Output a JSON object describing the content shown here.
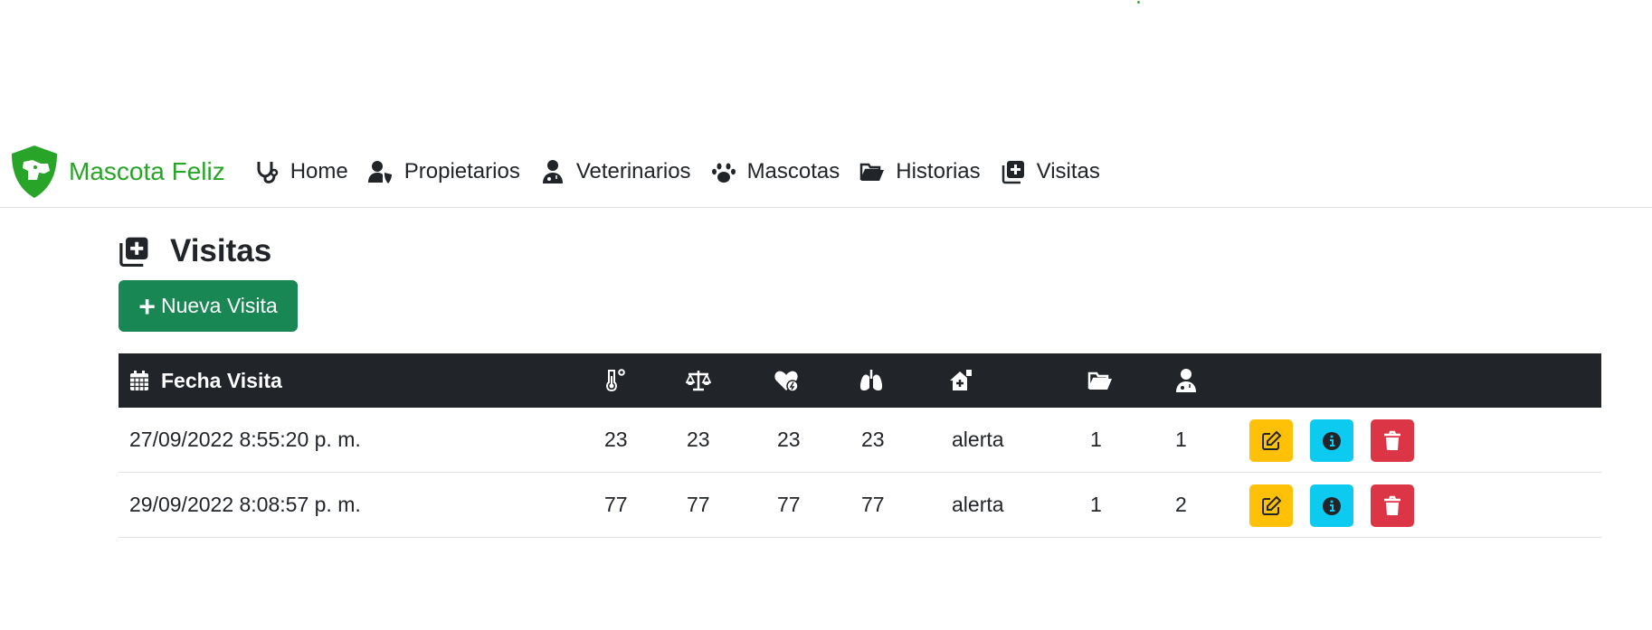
{
  "brand": {
    "name": "Mascota Feliz",
    "logo_icon": "dog-shield-icon",
    "color": "#28a428"
  },
  "nav": {
    "items": [
      {
        "label": "Home",
        "icon": "stethoscope-icon"
      },
      {
        "label": "Propietarios",
        "icon": "user-shield-icon"
      },
      {
        "label": "Veterinarios",
        "icon": "user-doctor-icon"
      },
      {
        "label": "Mascotas",
        "icon": "paw-icon"
      },
      {
        "label": "Historias",
        "icon": "folder-open-icon"
      },
      {
        "label": "Visitas",
        "icon": "notes-medical-icon"
      }
    ]
  },
  "page": {
    "title": "Visitas",
    "title_icon": "notes-medical-icon",
    "new_button": {
      "label": "Nueva Visita",
      "color": "#198754"
    }
  },
  "table": {
    "header": {
      "date_label": "Fecha Visita",
      "icons": [
        "calendar-icon",
        "temperature-icon",
        "scale-icon",
        "heart-pulse-icon",
        "lungs-icon",
        "house-medical-icon",
        "folder-open-icon",
        "user-doctor-icon"
      ],
      "background": "#212529"
    },
    "rows": [
      {
        "fecha": "27/09/2022 8:55:20 p. m.",
        "temperatura": "23",
        "peso": "23",
        "frecuencia_cardiaca": "23",
        "frecuencia_respiratoria": "23",
        "estado": "alerta",
        "historia": "1",
        "veterinario": "1"
      },
      {
        "fecha": "29/09/2022 8:08:57 p. m.",
        "temperatura": "77",
        "peso": "77",
        "frecuencia_cardiaca": "77",
        "frecuencia_respiratoria": "77",
        "estado": "alerta",
        "historia": "1",
        "veterinario": "2"
      }
    ],
    "actions": [
      {
        "name": "edit",
        "icon": "pen-to-square-icon",
        "color": "#ffc107"
      },
      {
        "name": "info",
        "icon": "circle-info-icon",
        "color": "#0dcaf0"
      },
      {
        "name": "delete",
        "icon": "trash-icon",
        "color": "#dc3545"
      }
    ]
  }
}
